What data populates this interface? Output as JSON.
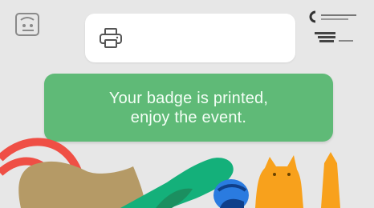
{
  "banner": {
    "line1": "Your badge is printed,",
    "line2": "enjoy the event."
  },
  "icons": {
    "top_left": "event-logo-icon",
    "printer": "printer-icon",
    "sponsor_top": "sponsor-logo-icon",
    "sponsor_bottom": "sponsor-logo-icon"
  },
  "colors": {
    "background": "#e7e7e7",
    "card": "#ffffff",
    "success_banner": "#5fba77",
    "banner_text": "#f4fff6"
  }
}
